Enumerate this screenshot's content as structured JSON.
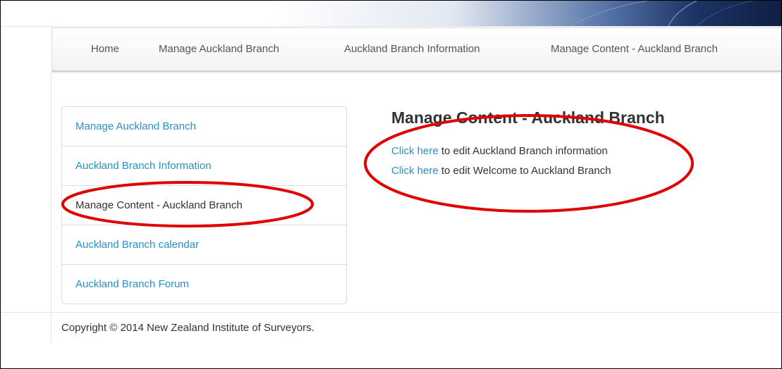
{
  "navbar": {
    "items": [
      {
        "label": "Home"
      },
      {
        "label": "Manage Auckland Branch"
      },
      {
        "label": "Auckland Branch Information"
      },
      {
        "label": "Manage Content - Auckland Branch"
      }
    ]
  },
  "sidebar": {
    "items": [
      {
        "label": "Manage Auckland Branch",
        "active": false
      },
      {
        "label": "Auckland Branch Information",
        "active": false
      },
      {
        "label": "Manage Content - Auckland Branch",
        "active": true
      },
      {
        "label": "Auckland Branch calendar",
        "active": false
      },
      {
        "label": "Auckland Branch Forum",
        "active": false
      }
    ]
  },
  "main": {
    "title": "Manage Content - Auckland Branch",
    "links": [
      {
        "link_text": "Click here",
        "rest": "to edit Auckland Branch information"
      },
      {
        "link_text": "Click here",
        "rest": "to edit Welcome to Auckland Branch"
      }
    ]
  },
  "footer": {
    "copyright": "Copyright © 2014 New Zealand Institute of Surveyors."
  },
  "colors": {
    "link": "#2a90c5",
    "text": "#333333",
    "annotation": "#e00000"
  }
}
